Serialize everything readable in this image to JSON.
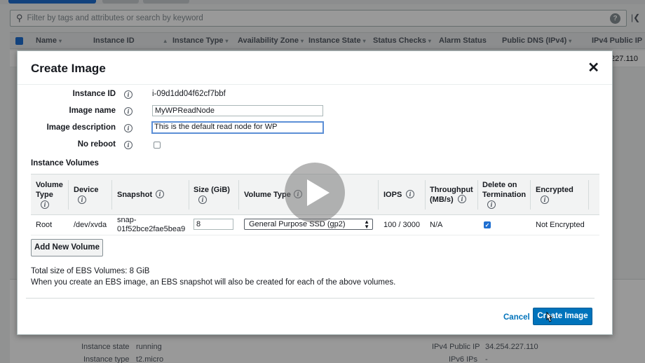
{
  "console": {
    "search_placeholder": "Filter by tags and attributes or search by keyword",
    "search_icon": "search-icon",
    "help_icon": "help-icon",
    "columns": [
      "Name",
      "Instance ID",
      "Instance Type",
      "Availability Zone",
      "Instance State",
      "Status Checks",
      "Alarm Status",
      "Public DNS (IPv4)",
      "IPv4 Public IP"
    ],
    "row_ip_fragment": "4.227.110",
    "details": [
      {
        "label": "Instance state",
        "value": "running"
      },
      {
        "label": "Instance type",
        "value": "t2.micro"
      },
      {
        "label": "IPv4 Public IP",
        "value": "34.254.227.110"
      },
      {
        "label": "IPv6 IPs",
        "value": "-"
      }
    ]
  },
  "modal": {
    "title": "Create Image",
    "close_icon": "close-icon",
    "fields": {
      "instance_id_label": "Instance ID",
      "instance_id_value": "i-09d1dd04f62cf7bbf",
      "image_name_label": "Image name",
      "image_name_value": "MyWPReadNode",
      "image_description_label": "Image description",
      "image_description_value": "This is the default read node for WP",
      "no_reboot_label": "No reboot",
      "no_reboot_checked": false
    },
    "volumes": {
      "section_title": "Instance Volumes",
      "headers": {
        "volume_type_1": "Volume Type",
        "device": "Device",
        "snapshot": "Snapshot",
        "size": "Size (GiB)",
        "volume_type_2": "Volume Type",
        "iops": "IOPS",
        "throughput": "Throughput (MB/s)",
        "delete_on_termination": "Delete on Termination",
        "encrypted": "Encrypted"
      },
      "row": {
        "volume_type": "Root",
        "device": "/dev/xvda",
        "snapshot": "snap-01f52bce2fae5bea9",
        "size": "8",
        "volume_type_select": "General Purpose SSD (gp2)",
        "iops": "100 / 3000",
        "throughput": "N/A",
        "delete_on_termination": true,
        "encrypted": "Not Encrypted"
      },
      "add_button": "Add New Volume"
    },
    "total_text": "Total size of EBS Volumes: 8 GiB",
    "note_text": "When you create an EBS image, an EBS snapshot will also be created for each of the above volumes.",
    "cancel_label": "Cancel",
    "create_label": "Create Image"
  },
  "overlay": {
    "play_icon": "play-icon"
  },
  "colors": {
    "primary_button": "#0073bb",
    "link": "#0073bb",
    "checkbox": "#1f6fd1"
  }
}
